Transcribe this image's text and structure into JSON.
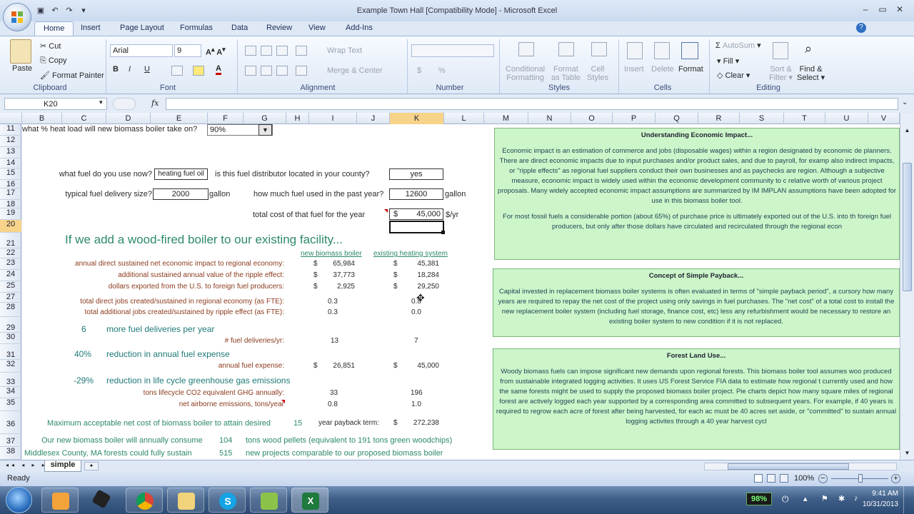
{
  "window": {
    "title": "Example Town Hall  [Compatibility Mode] - Microsoft Excel"
  },
  "tabs": [
    "Home",
    "Insert",
    "Page Layout",
    "Formulas",
    "Data",
    "Review",
    "View",
    "Add-Ins"
  ],
  "ribbon": {
    "clipboard": {
      "paste": "Paste",
      "cut": "Cut",
      "copy": "Copy",
      "format_painter": "Format Painter",
      "label": "Clipboard"
    },
    "font": {
      "name": "Arial",
      "size": "9",
      "label": "Font"
    },
    "alignment": {
      "wrap_text": "Wrap Text",
      "merge_center": "Merge & Center",
      "label": "Alignment"
    },
    "number": {
      "label": "Number",
      "currency": "$",
      "percent": "%"
    },
    "styles": {
      "conditional": "Conditional",
      "formatting": "Formatting",
      "format_as": "Format",
      "as_table": "as Table",
      "cell": "Cell",
      "styles_word": "Styles",
      "label": "Styles"
    },
    "cells": {
      "insert": "Insert",
      "delete": "Delete",
      "format": "Format",
      "label": "Cells"
    },
    "editing": {
      "autosum": "AutoSum",
      "fill": "Fill",
      "clear": "Clear",
      "sort": "Sort &",
      "filter": "Filter",
      "find": "Find &",
      "select": "Select",
      "label": "Editing"
    }
  },
  "formula_bar": {
    "name_box": "K20",
    "fx": "fx",
    "value": ""
  },
  "columns": [
    "B",
    "C",
    "D",
    "E",
    "F",
    "G",
    "H",
    "I",
    "J",
    "K",
    "L",
    "M",
    "N",
    "O",
    "P",
    "Q",
    "R",
    "S",
    "T",
    "U",
    "V"
  ],
  "selected_column": "K",
  "rows": [
    "11",
    "12",
    "13",
    "14",
    "15",
    "16",
    "17",
    "18",
    "19",
    "20",
    "21",
    "22",
    "23",
    "24",
    "25",
    "27",
    "28",
    "29",
    "30",
    "31",
    "32",
    "33",
    "34",
    "35",
    "36",
    "37",
    "38"
  ],
  "selected_row": "20",
  "sheet": {
    "r11_label": "what % heat load will new biomass boiler take on?",
    "r11_value": "90%",
    "r15_q1": "what fuel do you use now?",
    "r15_fuel": "heating fuel oil",
    "r15_q2": "is this fuel distributor located in your county?",
    "r15_yes": "yes",
    "r17_q1": "typical fuel delivery size?",
    "r17_size": "2000",
    "r17_unit1": "gallon",
    "r17_q2": "how much fuel used in the past year?",
    "r17_used": "12600",
    "r17_unit2": "gallon",
    "r19_q": "total cost of that fuel for the year",
    "r19_dollar": "$",
    "r19_value": "45,000",
    "r19_unit": "$/yr",
    "r21_heading": "If we add a wood-fired boiler to our existing facility...",
    "r22_col1": "new biomass boiler",
    "r22_col2": "existing heating system",
    "impact_rows": [
      {
        "label": "annual direct sustained net economic impact to regional economy:",
        "d1": "$",
        "v1": "65,984",
        "d2": "$",
        "v2": "45,381"
      },
      {
        "label": "additional sustained annual value of the ripple effect:",
        "d1": "$",
        "v1": "37,773",
        "d2": "$",
        "v2": "18,284"
      },
      {
        "label": "dollars exported from the U.S. to foreign fuel producers:",
        "d1": "$",
        "v1": "2,925",
        "d2": "$",
        "v2": "29,250"
      }
    ],
    "jobs_rows": [
      {
        "label": "total direct jobs created/sustained in regional economy (as FTE):",
        "v1": "0.3",
        "v2": "0.8"
      },
      {
        "label": "total additional jobs created/sustained by ripple effect (as FTE):",
        "v1": "0.3",
        "v2": "0.0"
      }
    ],
    "r29_num": "6",
    "r29_text": "more fuel deliveries per year",
    "r30_label": "# fuel deliveries/yr:",
    "r30_v1": "13",
    "r30_v2": "7",
    "r31_num": "40%",
    "r31_text": "reduction in annual fuel expense",
    "r32_label": "annual fuel expense:",
    "r32_d1": "$",
    "r32_v1": "26,851",
    "r32_d2": "$",
    "r32_v2": "45,000",
    "r33_num": "-29%",
    "r33_text": "reduction in life cycle greenhouse gas emissions",
    "r34_label": "tons lifecycle CO2 equivalent GHG annually:",
    "r34_v1": "33",
    "r34_v2": "196",
    "r35_label": "net airborne emissions, tons/year",
    "r35_v1": "0.8",
    "r35_v2": "1.0",
    "r36_label": "Maximum acceptable net cost of biomass boiler to attain desired",
    "r36_years": "15",
    "r36_term": "year payback term:",
    "r36_dollar": "$",
    "r36_value": "272,238",
    "r37_label": "Our new biomass boiler will annually consume",
    "r37_num": "104",
    "r37_text": "tons wood pellets (equivalent to 191 tons green woodchips)",
    "r38_label": "Middlesex County, MA forests could fully sustain",
    "r38_num": "515",
    "r38_text": "new projects comparable to our proposed biomass boiler"
  },
  "panels": {
    "economic": {
      "title": "Understanding Economic Impact...",
      "body": "Economic impact is an estimation of commerce and jobs (disposable wages) within a region designated by economic de planners. There are direct economic impacts due to input purchases and/or product sales, and due to payroll, for examp also indirect impacts, or \"ripple effects\" as regional fuel suppliers conduct their own businesses and as paychecks are region. Although a subjective measure, economic impact is widely used within the economic development community to c relative worth of various project proposals. Many widely accepted economic impact assumptions are summarized by IM IMPLAN assumptions have been adopted for use in this biomass boiler tool.",
      "body2": "For most fossil fuels a considerable portion (about 65%) of purchase price is ultimately exported out of the U.S. into th foreign fuel producers, but only after those dollars have circulated and recirculated through the regional econ"
    },
    "payback": {
      "title": "Concept of Simple Payback...",
      "body": "Capital invested in replacement biomass boiler systems is often evaluated in terms of \"simple payback period\", a cursory how many years are required to repay the net cost of the project using only savings in fuel purchases. The \"net cost\" of a total cost to install the new replacement boiler system (including fuel storage, finance cost, etc) less any refurbishment would be necessary to restore an existing boiler system to new condition if it is not replaced."
    },
    "forest": {
      "title": "Forest Land Use...",
      "body": "Woody biomass fuels can impose significant new demands upon regional forests. This biomass boiler tool assumes woo produced from sustainable integrated logging activities. It uses US Forest Service FIA data to estimate how regional t currently used and how the same forests might be used to supply the proposed biomass boiler project. Pie charts depict how many square miles of regional forest are actively logged each year supported by a corresponding area committed to subsequent years. For example, if 40 years is required to regrow each acre of forest after being harvested, for each ac must be 40 acres set aside, or \"committed\" to sustain annual logging activites through a 40 year harvest cycl"
    }
  },
  "sheet_tab": "simple",
  "status": {
    "ready": "Ready",
    "zoom": "100%"
  },
  "tray": {
    "battery": "98%",
    "time": "9:41 AM",
    "date": "10/31/2013"
  },
  "taskbar_apps": [
    "start-orb",
    "media-player",
    "pen-tool",
    "chrome",
    "file-explorer",
    "skype",
    "messenger",
    "excel"
  ],
  "colors": {
    "brown": "#8b3b1d",
    "green": "#2d8a66",
    "panel": "#ccf6c9",
    "selection": "#f8d38a"
  }
}
